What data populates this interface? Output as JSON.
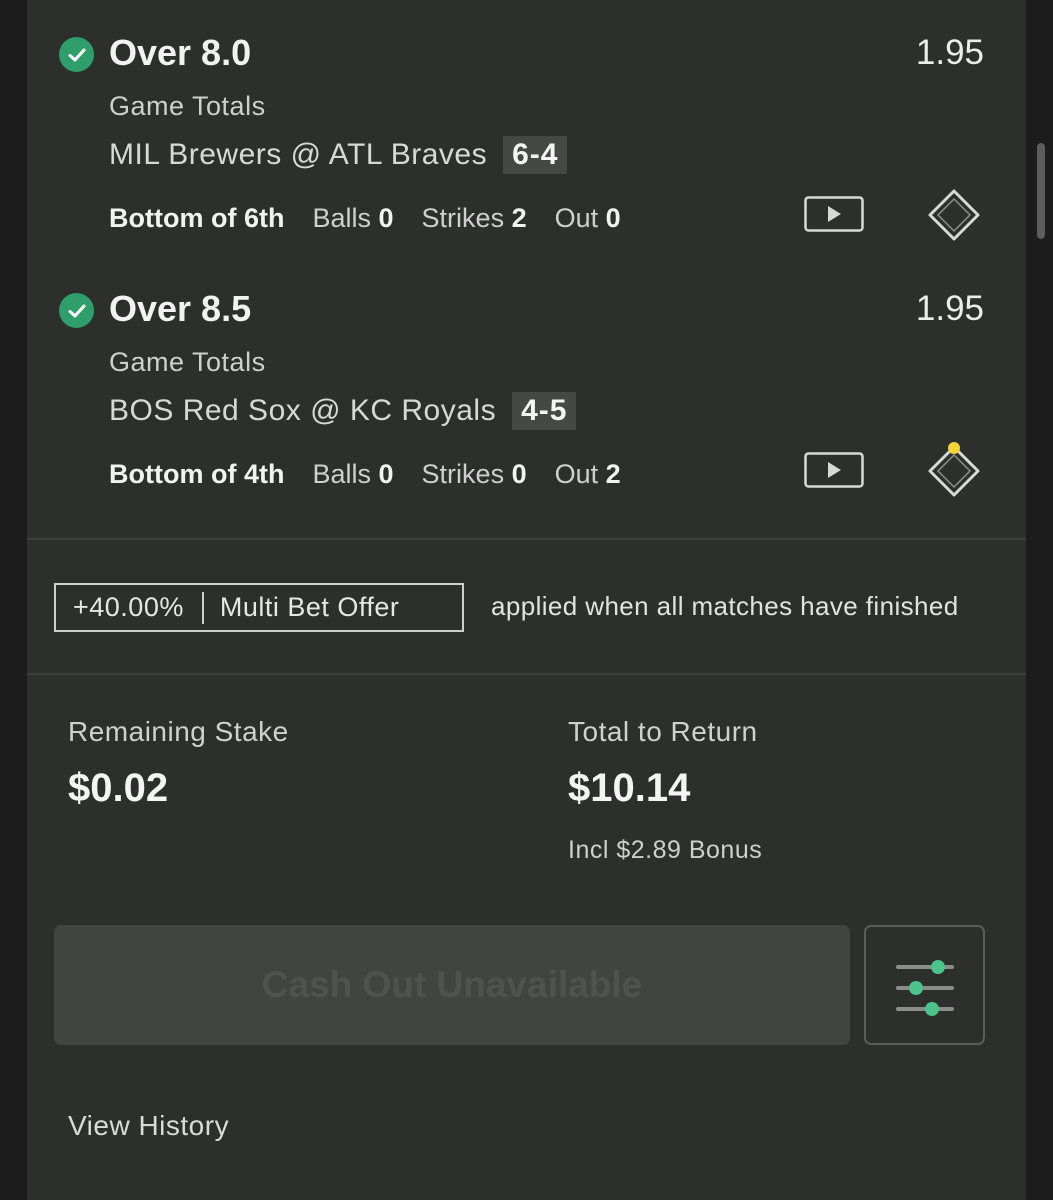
{
  "colors": {
    "accent_green": "#2f9e6a",
    "score_bg": "#464846",
    "runner_yellow": "#f2d43d",
    "panel_bg": "#2d2f2d"
  },
  "selections": [
    {
      "title": "Over 8.0",
      "odds": "1.95",
      "market": "Game Totals",
      "match": "MIL Brewers @ ATL Braves",
      "score": "6-4",
      "inning": "Bottom of 6th",
      "balls_label": "Balls",
      "balls": "0",
      "strikes_label": "Strikes",
      "strikes": "2",
      "out_label": "Out",
      "outs": "0",
      "status_icon": "check-icon",
      "stream_icon": "play-icon",
      "bases_icon": "baseball-diamond-icon",
      "bases_occupied": []
    },
    {
      "title": "Over 8.5",
      "odds": "1.95",
      "market": "Game Totals",
      "match": "BOS Red Sox @ KC Royals",
      "score": "4-5",
      "inning": "Bottom of 4th",
      "balls_label": "Balls",
      "balls": "0",
      "strikes_label": "Strikes",
      "strikes": "0",
      "out_label": "Out",
      "outs": "2",
      "status_icon": "check-icon",
      "stream_icon": "play-icon",
      "bases_icon": "baseball-diamond-icon",
      "bases_occupied": [
        "second"
      ]
    }
  ],
  "offer": {
    "percent": "+40.00%",
    "label": "Multi Bet Offer",
    "note": "applied when all matches have finished"
  },
  "stake": {
    "label": "Remaining Stake",
    "value": "$0.02"
  },
  "returns": {
    "label": "Total to Return",
    "value": "$10.14",
    "bonus": "Incl $2.89 Bonus"
  },
  "cashout": {
    "label": "Cash Out Unavailable"
  },
  "settings": {
    "icon": "sliders-icon"
  },
  "history": {
    "label": "View History"
  }
}
